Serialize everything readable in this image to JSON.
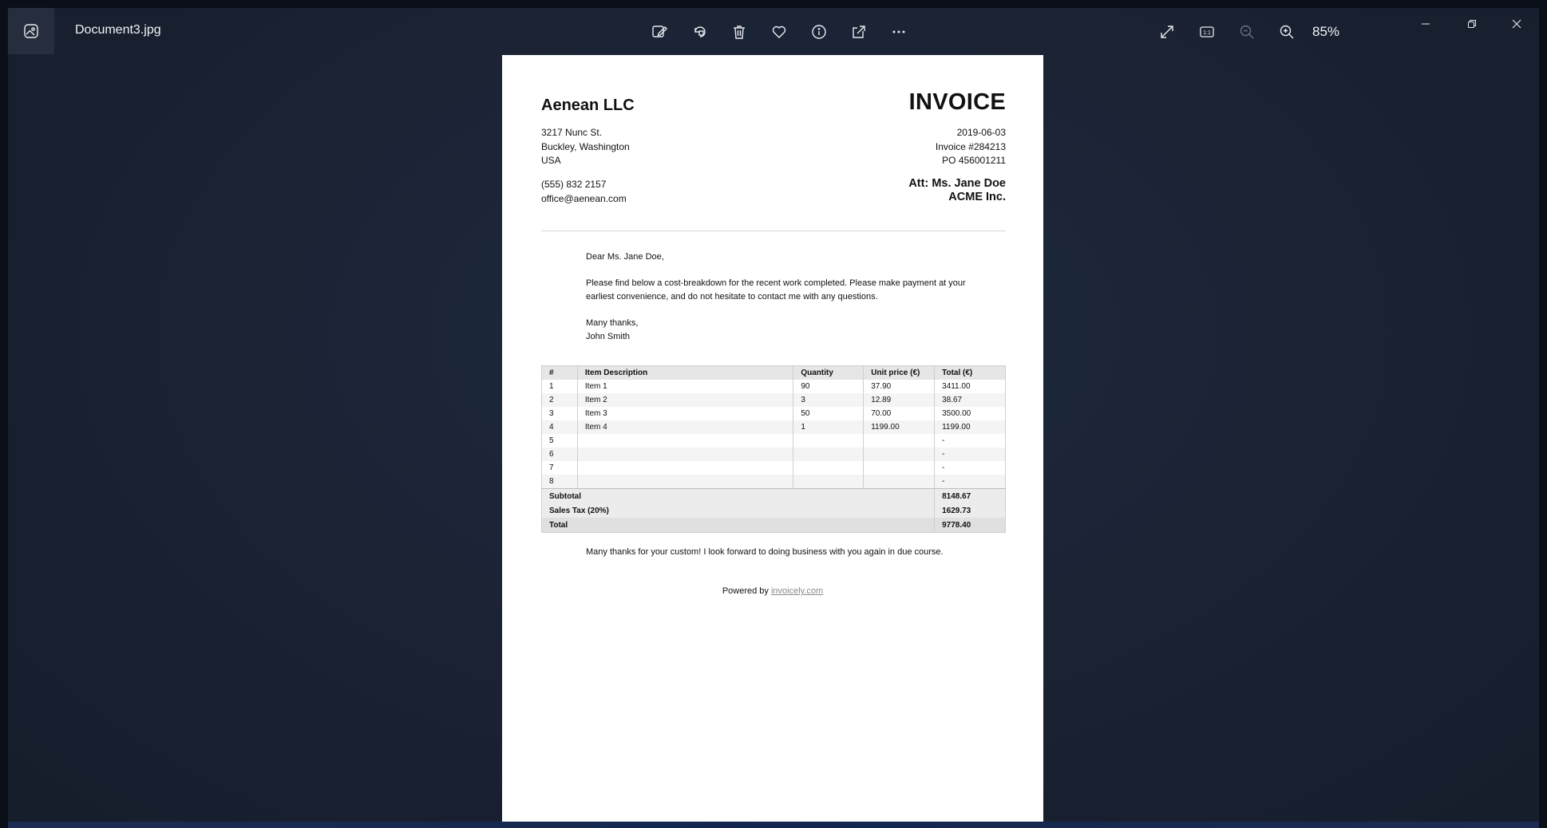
{
  "titlebar": {
    "file_name": "Document3.jpg",
    "zoom": "85%",
    "tools": [
      "edit-image-icon",
      "rotate-icon",
      "delete-icon",
      "favorite-icon",
      "info-icon",
      "share-icon",
      "more-options-icon"
    ],
    "right_tools": [
      "fullscreen-icon",
      "actual-size-icon",
      "zoom-out-icon",
      "zoom-in-icon"
    ]
  },
  "document": {
    "company": "Aenean LLC",
    "title": "INVOICE",
    "address": [
      "3217 Nunc St.",
      "Buckley, Washington",
      "USA"
    ],
    "contact": [
      "(555) 832 2157",
      "office@aenean.com"
    ],
    "meta": [
      "2019-06-03",
      "Invoice #284213",
      "PO 456001211"
    ],
    "attention": [
      "Att: Ms. Jane Doe",
      "ACME Inc."
    ],
    "greeting": "Dear Ms. Jane Doe,",
    "body": "Please find below a cost-breakdown for the recent work completed. Please make payment at your earliest convenience, and do not hesitate to contact me with any questions.",
    "signoff": [
      "Many thanks,",
      "John Smith"
    ],
    "table": {
      "headers": [
        "#",
        "Item Description",
        "Quantity",
        "Unit price (€)",
        "Total (€)"
      ],
      "rows": [
        [
          "1",
          "Item 1",
          "90",
          "37.90",
          "3411.00"
        ],
        [
          "2",
          "Item 2",
          "3",
          "12.89",
          "38.67"
        ],
        [
          "3",
          "Item 3",
          "50",
          "70.00",
          "3500.00"
        ],
        [
          "4",
          "Item 4",
          "1",
          "1199.00",
          "1199.00"
        ],
        [
          "5",
          "",
          "",
          "",
          "-"
        ],
        [
          "6",
          "",
          "",
          "",
          "-"
        ],
        [
          "7",
          "",
          "",
          "",
          "-"
        ],
        [
          "8",
          "",
          "",
          "",
          "-"
        ]
      ],
      "subtotal_label": "Subtotal",
      "subtotal": "8148.67",
      "tax_label": "Sales Tax (20%)",
      "tax": "1629.73",
      "total_label": "Total",
      "total": "9778.40"
    },
    "closing": "Many thanks for your custom! I look forward to doing business with you again in due course.",
    "powered_by": "Powered by",
    "powered_link": "invoicely.com"
  }
}
